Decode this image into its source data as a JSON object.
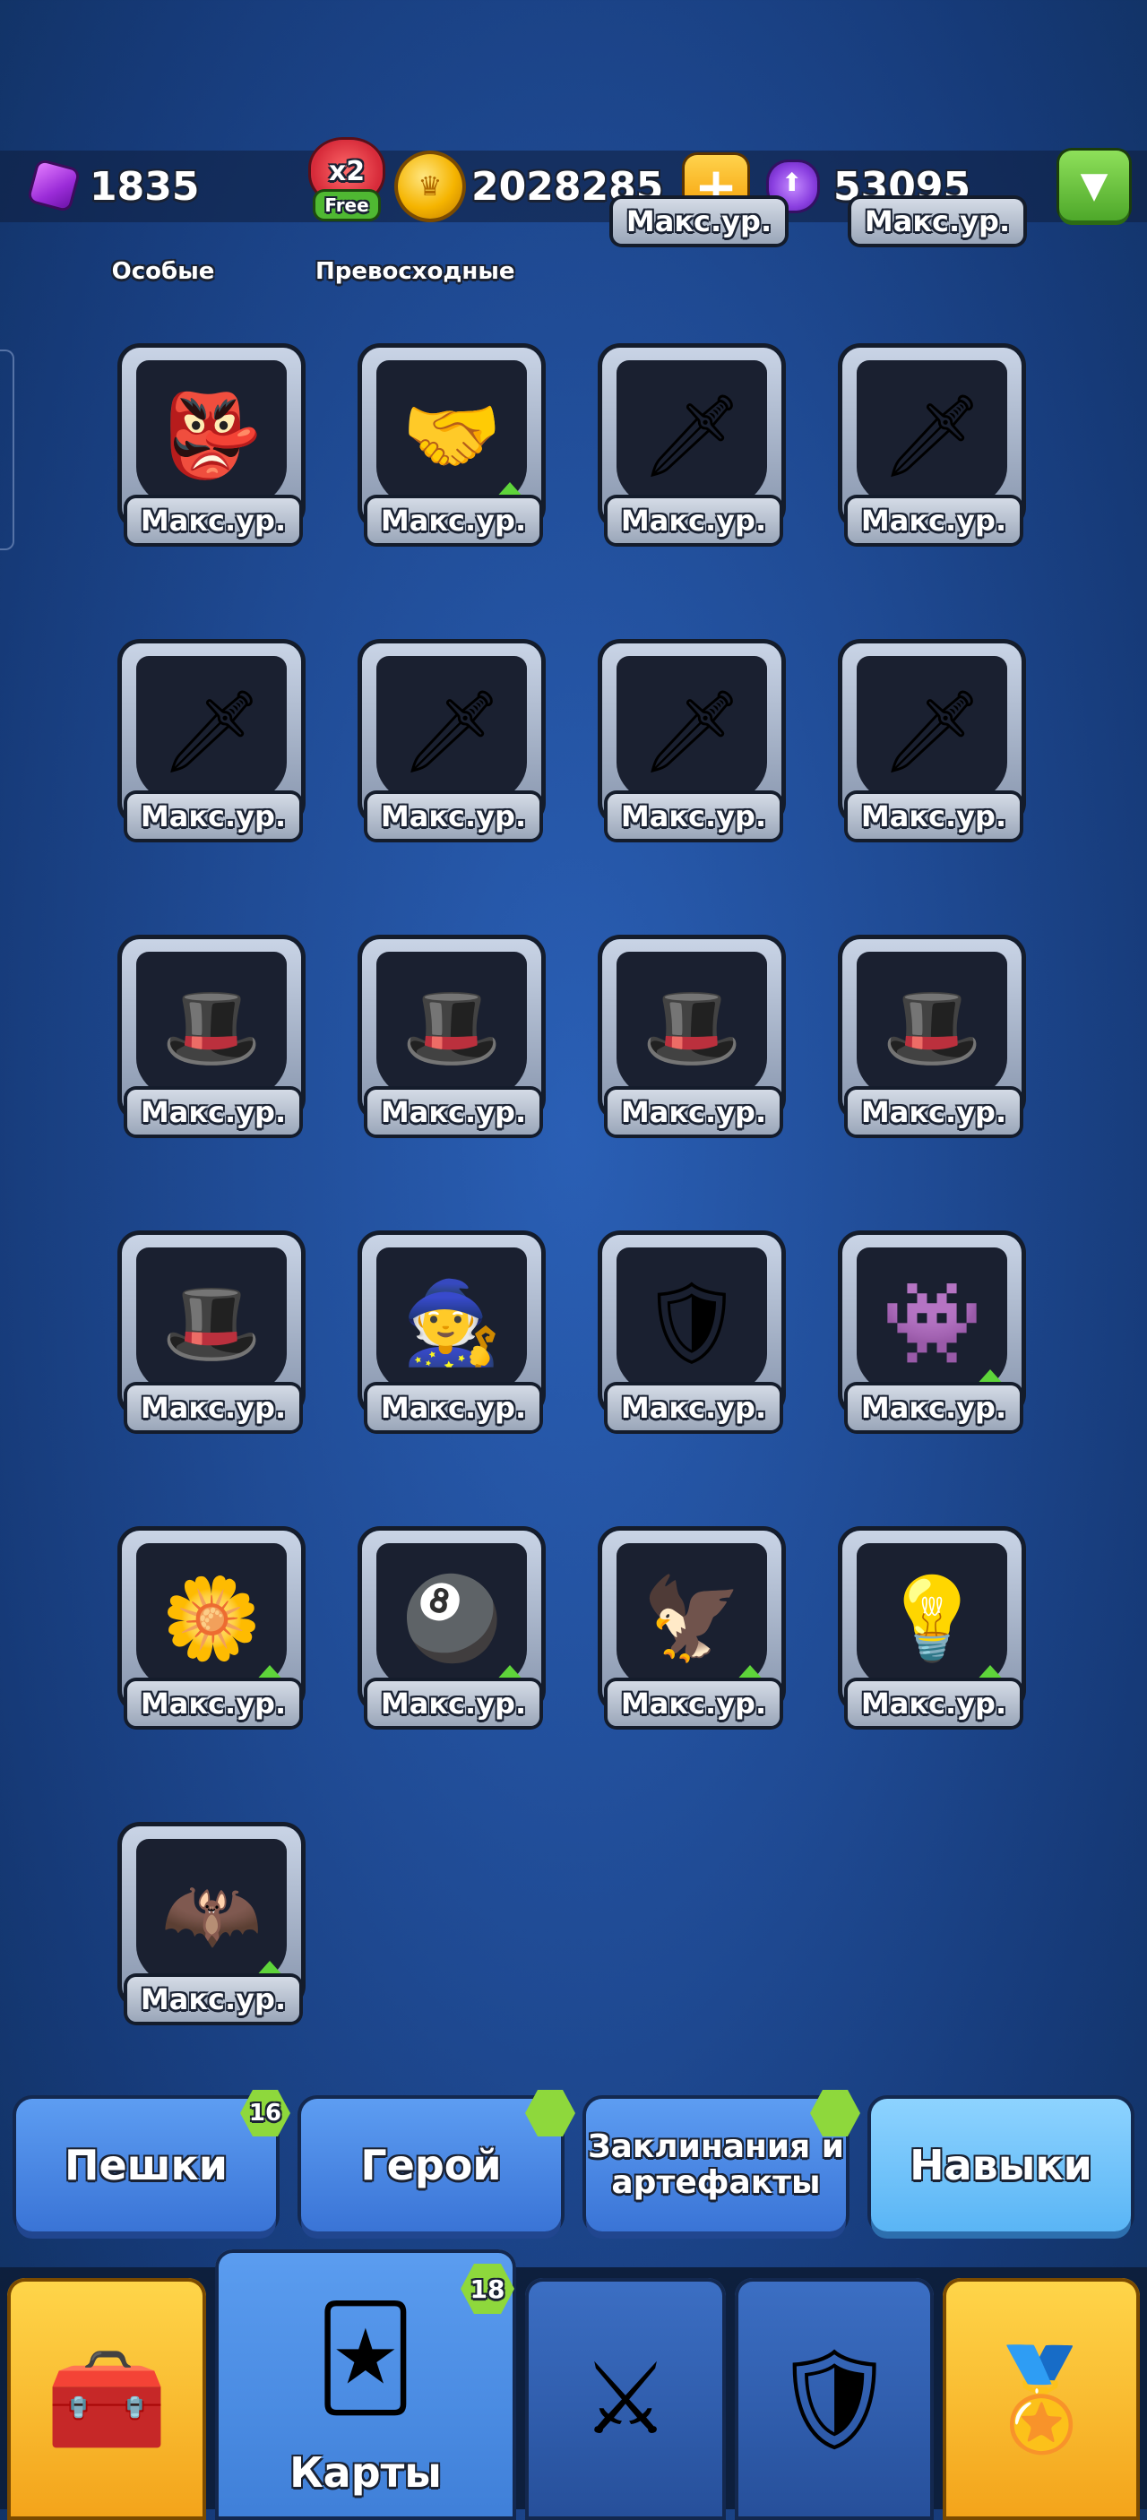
{
  "resources": {
    "gems": "1835",
    "x2": "x2",
    "free": "Free",
    "coins": "2028285",
    "trophies": "53095"
  },
  "partial_row": {
    "labels": [
      "Особые",
      "Превосходные",
      "Макс.ур.",
      "Макс.ур."
    ]
  },
  "cards": [
    {
      "name": "card-goblin-wizard",
      "icon": "👺",
      "level": "Макс.ур.",
      "upgrade": false
    },
    {
      "name": "card-handshake",
      "icon": "🤝",
      "level": "Макс.ур.",
      "upgrade": true
    },
    {
      "name": "card-sword-nature",
      "icon": "🗡",
      "level": "Макс.ур.",
      "upgrade": false
    },
    {
      "name": "card-sword-eightball",
      "icon": "🗡",
      "level": "Макс.ур.",
      "upgrade": false
    },
    {
      "name": "card-sword-eagle",
      "icon": "🗡",
      "level": "Макс.ур.",
      "upgrade": false
    },
    {
      "name": "card-sword-bulb",
      "icon": "🗡",
      "level": "Макс.ур.",
      "upgrade": false
    },
    {
      "name": "card-sword-bat",
      "icon": "🗡",
      "level": "Макс.ур.",
      "upgrade": false
    },
    {
      "name": "card-sword-wizard",
      "icon": "🗡",
      "level": "Макс.ур.",
      "upgrade": false
    },
    {
      "name": "card-hat-nature",
      "icon": "🎩",
      "level": "Макс.ур.",
      "upgrade": false
    },
    {
      "name": "card-hat-eightball",
      "icon": "🎩",
      "level": "Макс.ур.",
      "upgrade": false
    },
    {
      "name": "card-hat-eagle",
      "icon": "🎩",
      "level": "Макс.ур.",
      "upgrade": false
    },
    {
      "name": "card-hat-bulb",
      "icon": "🎩",
      "level": "Макс.ур.",
      "upgrade": false
    },
    {
      "name": "card-hat-bat",
      "icon": "🎩",
      "level": "Макс.ур.",
      "upgrade": false
    },
    {
      "name": "card-red-wizard",
      "icon": "🧙",
      "level": "Макс.ур.",
      "upgrade": false
    },
    {
      "name": "card-max-shield",
      "icon": "🛡",
      "level": "Макс.ур.",
      "upgrade": false
    },
    {
      "name": "card-pink-ghost",
      "icon": "👾",
      "level": "Макс.ур.",
      "upgrade": true
    },
    {
      "name": "card-nature-upgrade",
      "icon": "🌼",
      "level": "Макс.ур.",
      "upgrade": true
    },
    {
      "name": "card-eightball-upgrade",
      "icon": "🎱",
      "level": "Макс.ур.",
      "upgrade": true
    },
    {
      "name": "card-eagle-upgrade",
      "icon": "🦅",
      "level": "Макс.ур.",
      "upgrade": true
    },
    {
      "name": "card-bulb-upgrade",
      "icon": "💡",
      "level": "Макс.ур.",
      "upgrade": true
    },
    {
      "name": "card-bat-upgrade",
      "icon": "🦇",
      "level": "Макс.ур.",
      "upgrade": true
    }
  ],
  "tabs": {
    "pawns": "Пешки",
    "pawns_badge": "16",
    "hero": "Герой",
    "spells": "Заклинания и артефакты",
    "skills": "Навыки"
  },
  "nav": {
    "cards_label": "Карты",
    "cards_badge": "18"
  }
}
